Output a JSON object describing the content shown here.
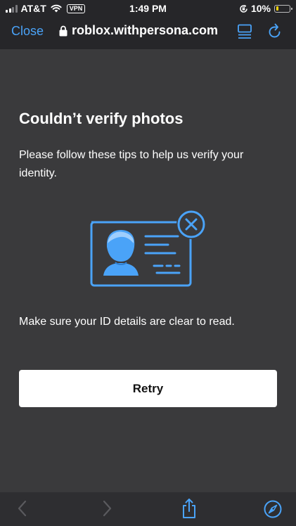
{
  "status_bar": {
    "carrier": "AT&T",
    "vpn": "VPN",
    "time": "1:49 PM",
    "battery": "10%",
    "battery_level": 0.1
  },
  "browser": {
    "close_label": "Close",
    "url": "roblox.withpersona.com"
  },
  "content": {
    "title": "Couldn’t verify photos",
    "subtitle": "Please follow these tips to help us verify your identity.",
    "tip": "Make sure your ID details are clear to read.",
    "retry_label": "Retry"
  },
  "colors": {
    "accent": "#4aa3f8",
    "background": "#3a3a3c",
    "bar": "#262629"
  },
  "icons": {
    "illustration": "id-card-error-icon",
    "toolbar": [
      "back-icon",
      "forward-icon",
      "share-icon",
      "safari-compass-icon"
    ]
  }
}
